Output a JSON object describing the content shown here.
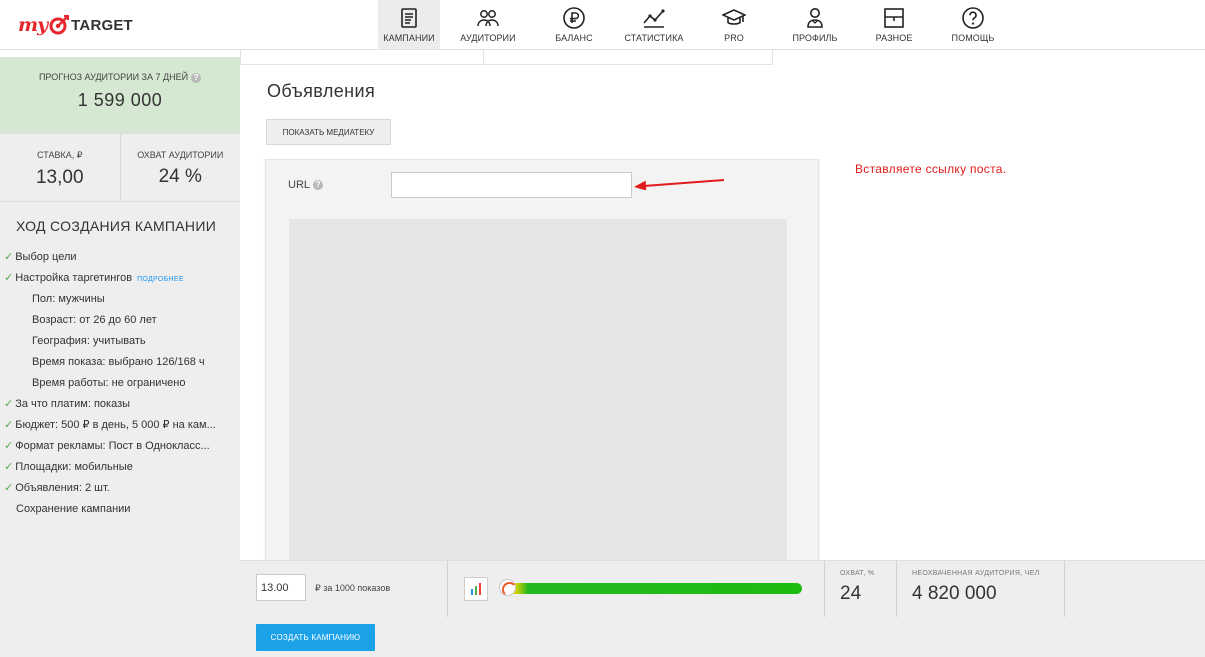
{
  "header": {
    "logo_prefix": "my",
    "logo_text": "TARGET",
    "nav": [
      {
        "id": "campaigns",
        "label": "КАМПАНИИ",
        "icon": "document-icon",
        "active": true
      },
      {
        "id": "audiences",
        "label": "АУДИТОРИИ",
        "icon": "users-icon",
        "active": false
      },
      {
        "id": "balance",
        "label": "БАЛАНС",
        "icon": "ruble-icon",
        "active": false
      },
      {
        "id": "statistics",
        "label": "СТАТИСТИКА",
        "icon": "chart-line-icon",
        "active": false
      },
      {
        "id": "pro",
        "label": "PRO",
        "icon": "graduation-cap-icon",
        "active": false
      },
      {
        "id": "profile",
        "label": "ПРОФИЛЬ",
        "icon": "user-icon",
        "active": false
      },
      {
        "id": "misc",
        "label": "РАЗНОЕ",
        "icon": "box-icon",
        "active": false
      },
      {
        "id": "help",
        "label": "ПОМОЩЬ",
        "icon": "question-icon",
        "active": false
      }
    ]
  },
  "sidebar": {
    "forecast_label": "ПРОГНОЗ АУДИТОРИИ ЗА 7 ДНЕЙ",
    "forecast_value": "1 599 000",
    "bid_label": "СТАВКА, ₽",
    "bid_value": "13,00",
    "reach_label": "ОХВАТ АУДИТОРИИ",
    "reach_value": "24 %",
    "progress_title": "ХОД СОЗДАНИЯ КАМПАНИИ",
    "more_link": "ПОДРОБНЕЕ",
    "steps": [
      {
        "text": "Выбор цели",
        "kind": "done"
      },
      {
        "text": "Настройка таргетингов",
        "kind": "done"
      },
      {
        "text": "Пол: мужчины",
        "kind": "sub"
      },
      {
        "text": "Возраст: от 26 до 60 лет",
        "kind": "sub"
      },
      {
        "text": "География: учитывать",
        "kind": "sub"
      },
      {
        "text": "Время показа: выбрано 126/168 ч",
        "kind": "sub"
      },
      {
        "text": "Время работы: не ограничено",
        "kind": "sub"
      },
      {
        "text": "За что платим: показы",
        "kind": "done"
      },
      {
        "text": "Бюджет: 500 ₽ в день, 5 000 ₽ на кам...",
        "kind": "done"
      },
      {
        "text": "Формат рекламы: Пост в Однокласс...",
        "kind": "done"
      },
      {
        "text": "Площадки: мобильные",
        "kind": "done"
      },
      {
        "text": "Объявления: 2 шт.",
        "kind": "done"
      },
      {
        "text": "Сохранение кампании",
        "kind": "plain"
      }
    ]
  },
  "main": {
    "section_title": "Объявления",
    "media_button": "ПОКАЗАТЬ МЕДИАТЕКУ",
    "url_label": "URL",
    "url_value": "",
    "note": "Вставляете ссылку поста."
  },
  "bottom": {
    "bid_value": "13.00",
    "bid_unit": "₽ за 1000 показов",
    "reach_label": "ОХВАТ, %",
    "reach_value": "24",
    "uncovered_label": "НЕОХВАЧЕННАЯ АУДИТОРИЯ, ЧЕЛ",
    "uncovered_value": "4 820 000",
    "create_button": "СОЗДАТЬ КАМПАНИЮ"
  },
  "colors": {
    "accent": "#1aa1e8",
    "logo_red": "#e8262c",
    "forecast_bg": "#d5e9d2",
    "note_red": "#e01b1b",
    "check_green": "#4caf50",
    "slider_green": "#26b820"
  }
}
